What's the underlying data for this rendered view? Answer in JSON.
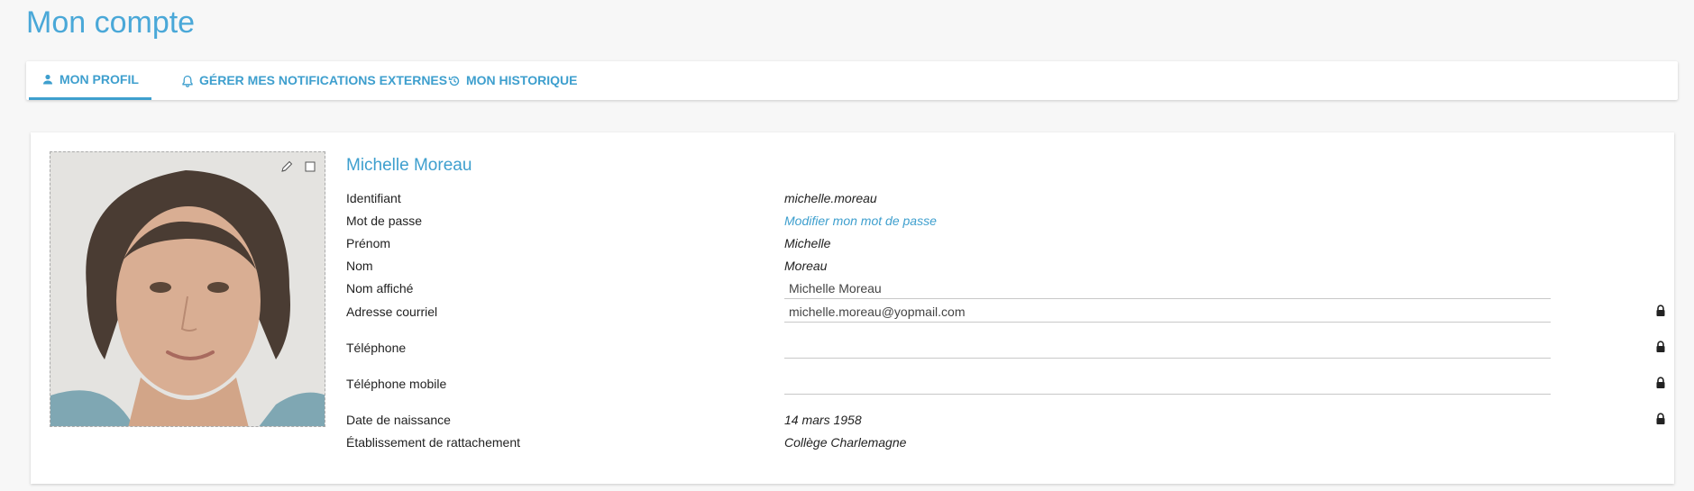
{
  "page": {
    "title": "Mon compte"
  },
  "tabs": [
    {
      "label": "MON PROFIL",
      "icon": "person-icon"
    },
    {
      "label": "GÉRER MES NOTIFICATIONS EXTERNES",
      "icon": "bell-icon"
    },
    {
      "label": "MON HISTORIQUE",
      "icon": "history-icon"
    }
  ],
  "profile": {
    "name": "Michelle Moreau",
    "fields": {
      "identifiant": {
        "label": "Identifiant",
        "value": "michelle.moreau"
      },
      "password": {
        "label": "Mot de passe",
        "value": "Modifier mon mot de passe"
      },
      "prenom": {
        "label": "Prénom",
        "value": "Michelle"
      },
      "nom": {
        "label": "Nom",
        "value": "Moreau"
      },
      "nom_affiche": {
        "label": "Nom affiché",
        "value": "Michelle Moreau"
      },
      "email": {
        "label": "Adresse courriel",
        "value": "michelle.moreau@yopmail.com"
      },
      "telephone": {
        "label": "Téléphone",
        "value": ""
      },
      "mobile": {
        "label": "Téléphone mobile",
        "value": ""
      },
      "naissance": {
        "label": "Date de naissance",
        "value": "14 mars 1958"
      },
      "etablissement": {
        "label": "Établissement de rattachement",
        "value": "Collège Charlemagne"
      }
    }
  },
  "colors": {
    "accent": "#3e9fce",
    "title": "#4aa8d8",
    "background": "#f7f7f7"
  }
}
